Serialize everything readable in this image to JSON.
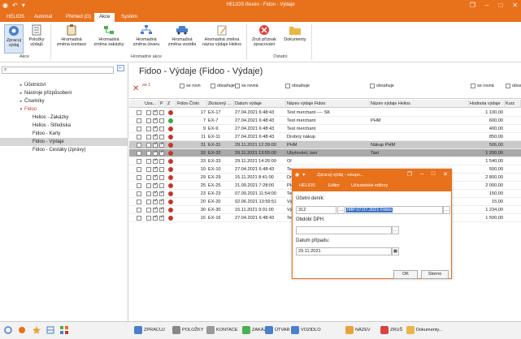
{
  "window": {
    "title": "HELIOS iNuvio - Fidoo - Výdaje"
  },
  "menu": {
    "tabs": [
      "HELIOS",
      "Automat",
      "Přehled (G)",
      "Akce",
      "Systém"
    ],
    "active": 3
  },
  "ribbon": {
    "buttons": [
      {
        "label": "Zpracuj\nvýdaj",
        "icon": "process-icon"
      },
      {
        "label": "Položky\nvýdajů",
        "icon": "document-icon"
      },
      {
        "label": "Hromadná\nzměna kontace",
        "icon": "clipboard-icon"
      },
      {
        "label": "Hromadná\nzměna zakázky",
        "icon": "tree-icon"
      },
      {
        "label": "Hromadná\nzměna útvaru",
        "icon": "org-chart-icon"
      },
      {
        "label": "Hromadná\nzměna vozidla",
        "icon": "car-icon"
      },
      {
        "label": "Hromadná změna\nnázvu výdaje Helios",
        "icon": "pencil-icon"
      },
      {
        "label": "Zruš příznak\nzpracování",
        "icon": "cancel-icon"
      },
      {
        "label": "Dokumenty",
        "icon": "folder-icon"
      }
    ],
    "groups": [
      "Akce",
      "Hromadné akce",
      "Ostatní"
    ]
  },
  "sidebar": {
    "search_placeholder": "",
    "items": [
      {
        "label": "Účetnictví",
        "arrow": "▸",
        "indent": 0
      },
      {
        "label": "Nástroje přizpůsobení",
        "arrow": "▸",
        "indent": 0
      },
      {
        "label": "Číselníky",
        "arrow": "▸",
        "indent": 0
      },
      {
        "label": "Fidoo",
        "arrow": "▾",
        "indent": 0,
        "red": true
      },
      {
        "label": "Helios - Zakázky",
        "indent": 1
      },
      {
        "label": "Helios - Střediska",
        "indent": 1
      },
      {
        "label": "Fidoo - Karty",
        "indent": 1
      },
      {
        "label": "Fidoo - Výdaje",
        "indent": 1,
        "selected": true
      },
      {
        "label": "Fidoo - Cestáky (zprávy)",
        "indent": 1
      }
    ]
  },
  "main": {
    "title": "Fidoo - Výdaje (Fidoo - Výdaje)",
    "filters": [
      "se 1",
      "se rovn",
      "obsahuje",
      "se rovná",
      "obsahuje",
      "obsahuje",
      "se rovná",
      "obsa"
    ],
    "columns": [
      "Uza...",
      "P",
      "Z",
      "Fidoo Číslo",
      "Zkrácený ...",
      "Datum výdaje",
      "Název výdaje Fidoo",
      "Název výdaje Helios",
      "Hodnota výdaje",
      "Kurz"
    ],
    "rows": [
      {
        "p": true,
        "z": false,
        "status": "red",
        "num": "17",
        "code": "EX-17",
        "date": "27.04.2021 6:48:43",
        "fidoo": "Test merchant ---- SK",
        "helios": "",
        "value": "1 100,00"
      },
      {
        "p": true,
        "z": false,
        "status": "green",
        "num": "7",
        "code": "EX-7",
        "date": "27.04.2021 6:48:43",
        "fidoo": "Test merchant",
        "helios": "PHM",
        "value": "600,00"
      },
      {
        "p": true,
        "z": false,
        "status": "red",
        "num": "9",
        "code": "EX-9",
        "date": "27.04.2021 6:48:43",
        "fidoo": "Test merchant",
        "helios": "",
        "value": "400,00"
      },
      {
        "p": true,
        "z": false,
        "status": "red",
        "num": "11",
        "code": "EX-11",
        "date": "27.04.2021 6:48:43",
        "fidoo": "Drobný nákup",
        "helios": "",
        "value": "850,00"
      },
      {
        "p": true,
        "z": true,
        "status": "red",
        "num": "31",
        "code": "EX-31",
        "date": "29.11.2021 12:39:00",
        "fidoo": "PHM",
        "helios": "Nákup PHM",
        "value": "506,00",
        "hl": "hl"
      },
      {
        "p": true,
        "z": true,
        "status": "red",
        "num": "32",
        "code": "EX-32",
        "date": "29.11.2021 13:55:00",
        "fidoo": "Ubytování, taxi",
        "helios": "Taxi",
        "value": "1 200,00",
        "hl": "hl2"
      },
      {
        "p": true,
        "z": false,
        "status": "red",
        "num": "33",
        "code": "EX-33",
        "date": "29.11.2021 14:26:00",
        "fidoo": "Ol",
        "helios": "",
        "value": "1 540,00"
      },
      {
        "p": true,
        "z": false,
        "status": "red",
        "num": "10",
        "code": "EX-10",
        "date": "27.04.2021 6:48:43",
        "fidoo": "Te",
        "helios": "",
        "value": "500,00"
      },
      {
        "p": true,
        "z": false,
        "status": "red",
        "num": "29",
        "code": "EX-29",
        "date": "15.11.2021 8:41:00",
        "fidoo": "Dr",
        "helios": "",
        "value": "2 800,00"
      },
      {
        "p": true,
        "z": false,
        "status": "red",
        "num": "25",
        "code": "EX-25",
        "date": "21.09.2021 7:28:00",
        "fidoo": "PH",
        "helios": "",
        "value": "2 000,00"
      },
      {
        "p": true,
        "z": true,
        "status": "red",
        "num": "23",
        "code": "EX-23",
        "date": "07.09.2021 11:54:00",
        "fidoo": "Te",
        "helios": "",
        "value": "150,00"
      },
      {
        "p": true,
        "z": true,
        "status": "red",
        "num": "20",
        "code": "EX-20",
        "date": "02.06.2021 13:59:51",
        "fidoo": "Vý",
        "helios": "",
        "value": "15,00"
      },
      {
        "p": true,
        "z": true,
        "status": "red",
        "num": "30",
        "code": "EX-30",
        "date": "15.11.2021 9:01:00",
        "fidoo": "Vý",
        "helios": "",
        "value": "1 234,00"
      },
      {
        "p": true,
        "z": true,
        "status": "red",
        "num": "16",
        "code": "EX-16",
        "date": "27.04.2021 6:48:43",
        "fidoo": "Te",
        "helios": "",
        "value": "1 500,00"
      }
    ]
  },
  "dialog": {
    "title": "Zpracuj výdaj - vstupn...",
    "menu": [
      "HELIOS",
      "Editor",
      "Uživatelské editory"
    ],
    "labels": {
      "ucetni_denik": "Účetní deník:",
      "obdobi_dph": "Období DPH:",
      "datum_pripadu": "Datum případu:"
    },
    "values": {
      "ucetni_denik": "312",
      "denik_name": "IMP 07.07.2021 Fidoo",
      "obdobi_dph": "",
      "datum_pripadu": "29.11.2021"
    },
    "ok": "OK",
    "cancel": "Storno"
  },
  "bottombar": {
    "items": [
      {
        "label": "ZPRACUJ",
        "color": "#4a7fc9"
      },
      {
        "label": "POLOŽKY",
        "color": "#888888"
      },
      {
        "label": "KONTACE",
        "color": "#999999"
      },
      {
        "label": "ZAKÁZKA",
        "color": "#4caf50"
      },
      {
        "label": "ÚTVAR",
        "color": "#4a7fc9"
      },
      {
        "label": "VOZIDLO",
        "color": "#4a7fc9"
      },
      {
        "label": "NÁZEV",
        "color": "#e8a33c"
      },
      {
        "label": "ZRUŠ",
        "color": "#d9433d"
      },
      {
        "label": "Dokumenty...",
        "color": "#e8b64a"
      }
    ]
  },
  "colors": {
    "accent": "#e8711c",
    "status_red": "#c0392b",
    "status_green": "#3aa845"
  }
}
